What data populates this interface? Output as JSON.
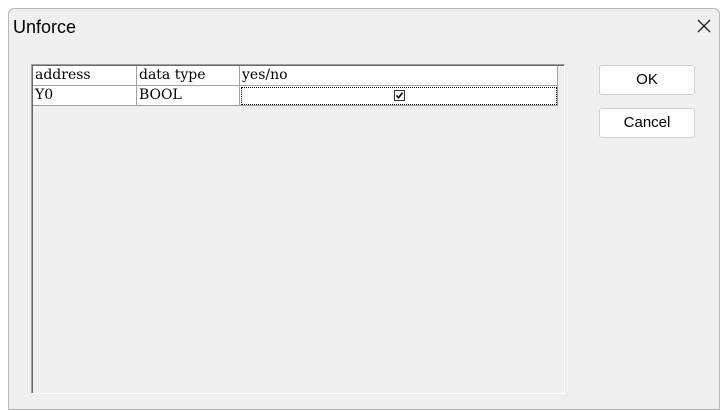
{
  "dialog": {
    "title": "Unforce",
    "close_icon": "close-icon"
  },
  "table": {
    "columns": [
      "address",
      "data type",
      "yes/no"
    ],
    "rows": [
      {
        "address": "Y0",
        "data_type": "BOOL",
        "yes_no": true
      }
    ]
  },
  "buttons": {
    "ok": "OK",
    "cancel": "Cancel"
  }
}
